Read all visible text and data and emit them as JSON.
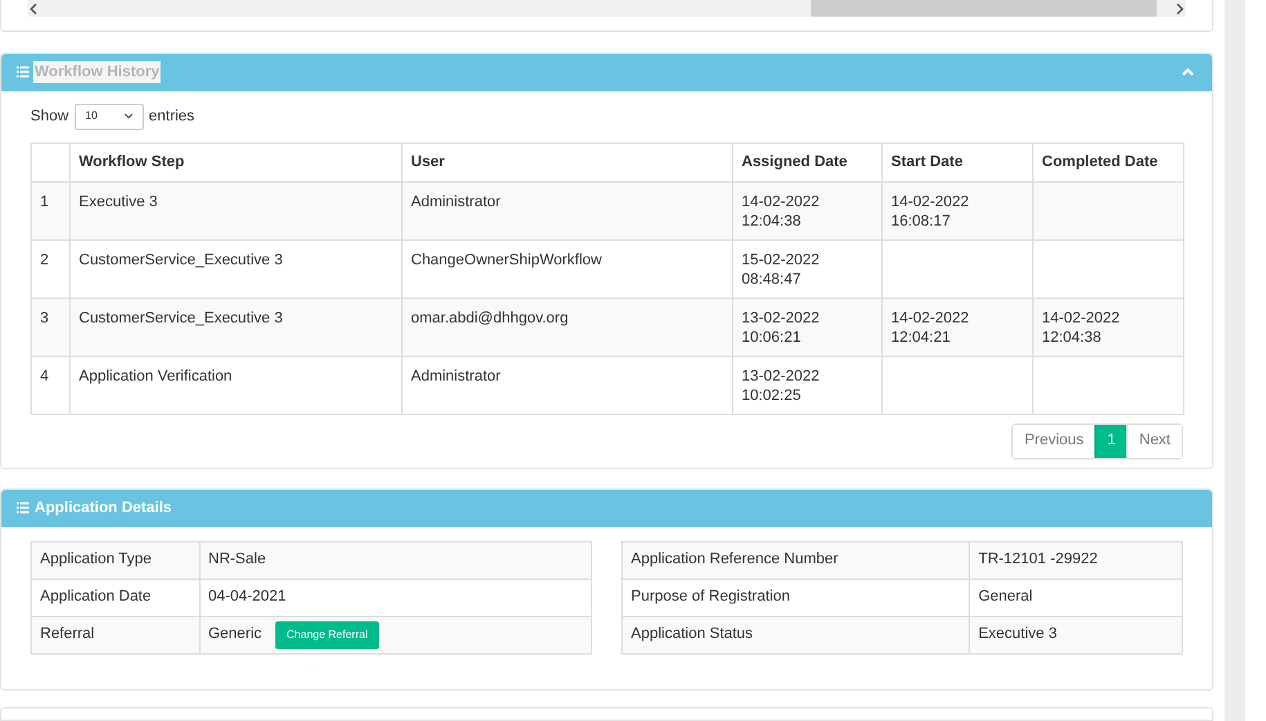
{
  "workflow_history": {
    "title": "Workflow History",
    "length_menu": {
      "prefix": "Show",
      "value": "10",
      "suffix": "entries"
    },
    "table": {
      "columns": [
        "",
        "Workflow Step",
        "User",
        "Assigned Date",
        "Start Date",
        "Completed Date"
      ],
      "rows": [
        [
          "1",
          "Executive 3",
          "Administrator",
          "14-02-2022\n12:04:38",
          "14-02-2022\n16:08:17",
          ""
        ],
        [
          "2",
          "CustomerService_Executive 3",
          "ChangeOwnerShipWorkflow",
          "15-02-2022\n08:48:47",
          "",
          ""
        ],
        [
          "3",
          "CustomerService_Executive 3",
          "omar.abdi@dhhgov.org",
          "13-02-2022\n10:06:21",
          "14-02-2022\n12:04:21",
          "14-02-2022\n12:04:38"
        ],
        [
          "4",
          "Application Verification",
          "Administrator",
          "13-02-2022\n10:02:25",
          "",
          ""
        ]
      ]
    },
    "pagination": [
      {
        "label": "Previous",
        "selected": false
      },
      {
        "label": "1",
        "selected": true
      },
      {
        "label": "Next",
        "selected": false
      }
    ]
  },
  "application_details": {
    "title": "Application Details",
    "left": [
      {
        "label": "Application Type",
        "value": "NR-Sale"
      },
      {
        "label": "Application Date",
        "value": "04-04-2021"
      },
      {
        "label": "Referral",
        "value": "Generic",
        "button": "Change Referral"
      }
    ],
    "right": [
      {
        "label": "Application Reference Number",
        "value": "TR-12101 -29922"
      },
      {
        "label": "Purpose of Registration",
        "value": "General"
      },
      {
        "label": "Application Status",
        "value": "Executive 3"
      }
    ]
  }
}
